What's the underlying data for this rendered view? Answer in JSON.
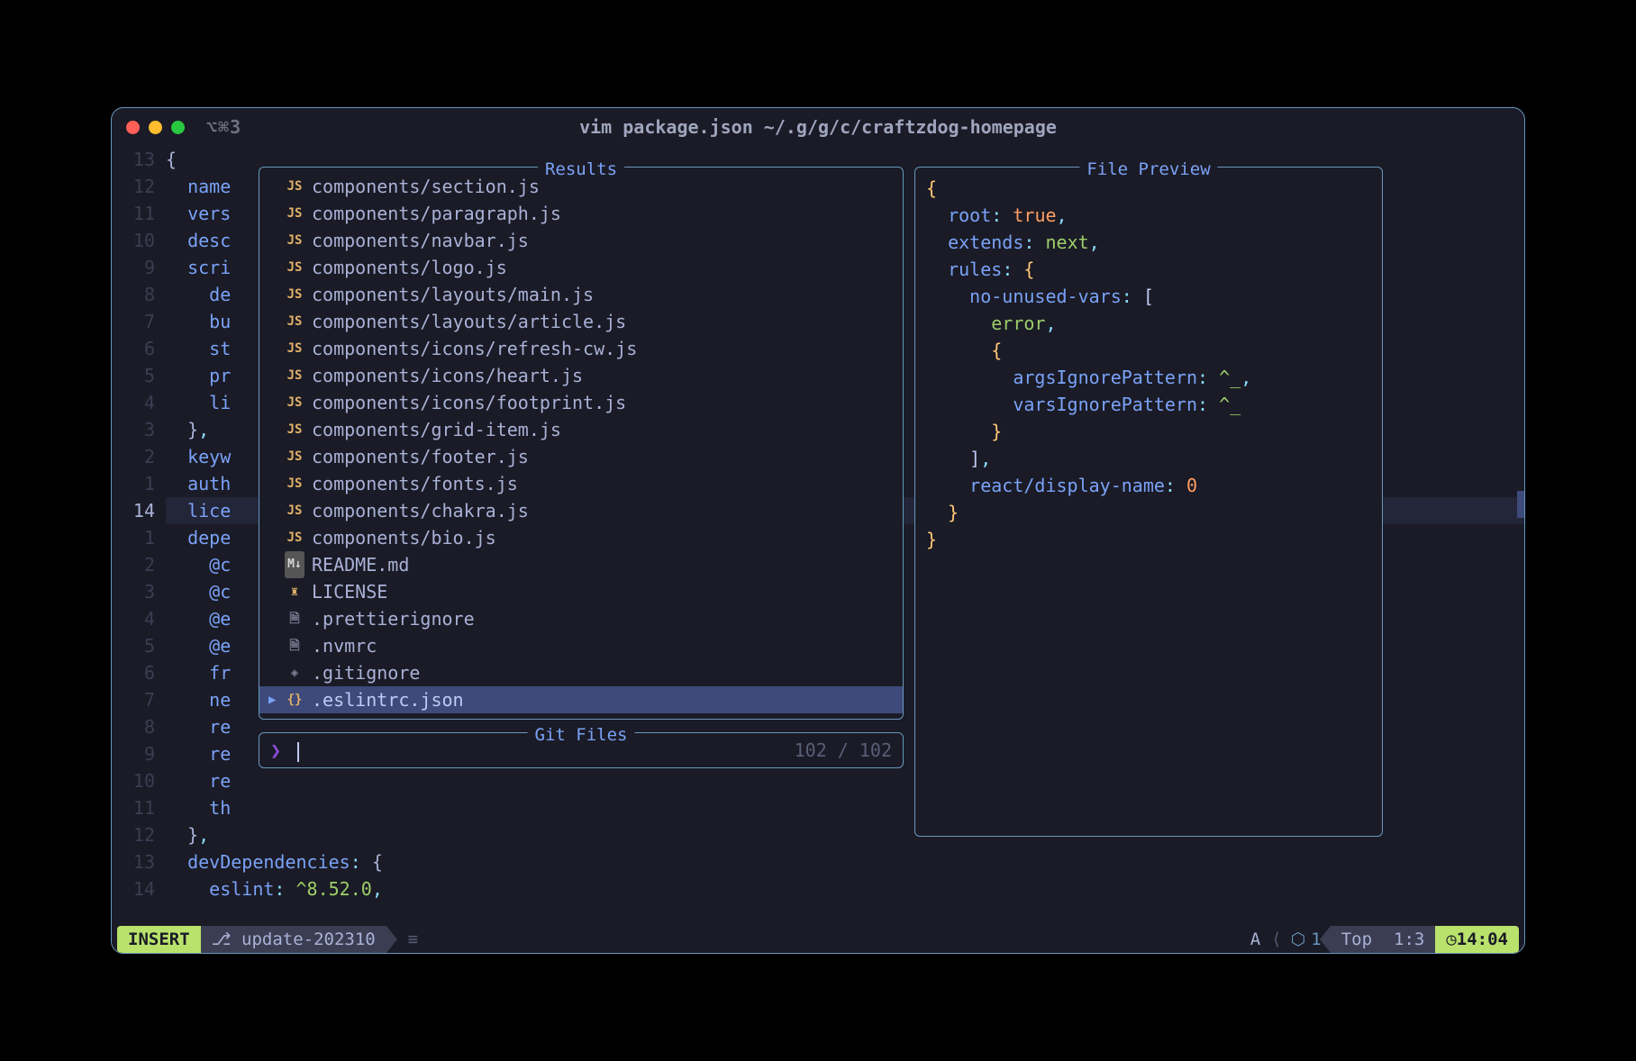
{
  "window": {
    "tab_indicator": "⌥⌘3",
    "title": "vim package.json ~/.g/g/c/craftzdog-homepage"
  },
  "gutter_numbers": [
    "13",
    "12",
    "11",
    "10",
    "9",
    "8",
    "7",
    "6",
    "5",
    "4",
    "3",
    "2",
    "1",
    "14",
    "1",
    "2",
    "3",
    "4",
    "5",
    "6",
    "7",
    "8",
    "9",
    "10",
    "11",
    "12",
    "13",
    "14"
  ],
  "gutter_current_index": 13,
  "code_visible": [
    "{",
    "  name",
    "  vers",
    "  desc",
    "  scri",
    "    de",
    "    bu",
    "    st",
    "    pr",
    "    li",
    "  },",
    "  keyw",
    "  auth",
    "  lice",
    "  depe",
    "    @c",
    "    @c",
    "    @e",
    "    @e",
    "    fr",
    "    ne",
    "    re",
    "    re",
    "    re",
    "    th",
    "  },",
    "  devDependencies: {",
    "    eslint: ^8.52.0,"
  ],
  "code_key_end": {
    "devDependencies": "devDependencies",
    "eslint": "eslint",
    "eslint_ver": "^8.52.0"
  },
  "panels": {
    "results_title": "Results",
    "gitfiles_title": "Git Files",
    "preview_title": "File Preview"
  },
  "results": [
    {
      "icon": "JS",
      "cls": "ic-js",
      "name": "components/section.js"
    },
    {
      "icon": "JS",
      "cls": "ic-js",
      "name": "components/paragraph.js"
    },
    {
      "icon": "JS",
      "cls": "ic-js",
      "name": "components/navbar.js"
    },
    {
      "icon": "JS",
      "cls": "ic-js",
      "name": "components/logo.js"
    },
    {
      "icon": "JS",
      "cls": "ic-js",
      "name": "components/layouts/main.js"
    },
    {
      "icon": "JS",
      "cls": "ic-js",
      "name": "components/layouts/article.js"
    },
    {
      "icon": "JS",
      "cls": "ic-js",
      "name": "components/icons/refresh-cw.js"
    },
    {
      "icon": "JS",
      "cls": "ic-js",
      "name": "components/icons/heart.js"
    },
    {
      "icon": "JS",
      "cls": "ic-js",
      "name": "components/icons/footprint.js"
    },
    {
      "icon": "JS",
      "cls": "ic-js",
      "name": "components/grid-item.js"
    },
    {
      "icon": "JS",
      "cls": "ic-js",
      "name": "components/footer.js"
    },
    {
      "icon": "JS",
      "cls": "ic-js",
      "name": "components/fonts.js"
    },
    {
      "icon": "JS",
      "cls": "ic-js",
      "name": "components/chakra.js"
    },
    {
      "icon": "JS",
      "cls": "ic-js",
      "name": "components/bio.js"
    },
    {
      "icon": "M↓",
      "cls": "ic-md",
      "name": "README.md"
    },
    {
      "icon": "♜",
      "cls": "ic-lic",
      "name": "LICENSE"
    },
    {
      "icon": "🗎",
      "cls": "ic-txt",
      "name": ".prettierignore"
    },
    {
      "icon": "🗎",
      "cls": "ic-txt",
      "name": ".nvmrc"
    },
    {
      "icon": "◈",
      "cls": "ic-git",
      "name": ".gitignore"
    },
    {
      "icon": "{}",
      "cls": "ic-json",
      "name": ".eslintrc.json",
      "selected": true
    }
  ],
  "search": {
    "prompt": "❯",
    "count_current": "102",
    "count_total": "102"
  },
  "preview_lines": [
    {
      "t": "{",
      "c": "pv-brace"
    },
    {
      "t": "  root: true,",
      "seg": [
        [
          "  ",
          "pv"
        ],
        [
          "root",
          "pv-key"
        ],
        [
          ": ",
          "pv-punct"
        ],
        [
          "true",
          "pv-bool"
        ],
        [
          ",",
          "pv-punct"
        ]
      ]
    },
    {
      "t": "  extends: next,",
      "seg": [
        [
          "  ",
          "pv"
        ],
        [
          "extends",
          "pv-key"
        ],
        [
          ": ",
          "pv-punct"
        ],
        [
          "next",
          "pv-str"
        ],
        [
          ",",
          "pv-punct"
        ]
      ]
    },
    {
      "t": "  rules: {",
      "seg": [
        [
          "  ",
          "pv"
        ],
        [
          "rules",
          "pv-key"
        ],
        [
          ": ",
          "pv-punct"
        ],
        [
          "{",
          "pv-brace"
        ]
      ]
    },
    {
      "t": "    no-unused-vars: [",
      "seg": [
        [
          "    ",
          "pv"
        ],
        [
          "no-unused-vars",
          "pv-key"
        ],
        [
          ": ",
          "pv-punct"
        ],
        [
          "[",
          "pv-brk"
        ]
      ]
    },
    {
      "t": "      error,",
      "seg": [
        [
          "      ",
          "pv"
        ],
        [
          "error",
          "pv-str"
        ],
        [
          ",",
          "pv-punct"
        ]
      ]
    },
    {
      "t": "      {",
      "seg": [
        [
          "      ",
          "pv"
        ],
        [
          "{",
          "pv-brace"
        ]
      ]
    },
    {
      "t": "        argsIgnorePattern: ^_,",
      "seg": [
        [
          "        ",
          "pv"
        ],
        [
          "argsIgnorePattern",
          "pv-key"
        ],
        [
          ": ",
          "pv-punct"
        ],
        [
          "^_",
          "pv-str"
        ],
        [
          ",",
          "pv-punct"
        ]
      ]
    },
    {
      "t": "        varsIgnorePattern: ^_",
      "seg": [
        [
          "        ",
          "pv"
        ],
        [
          "varsIgnorePattern",
          "pv-key"
        ],
        [
          ": ",
          "pv-punct"
        ],
        [
          "^_",
          "pv-str"
        ]
      ]
    },
    {
      "t": "      }",
      "seg": [
        [
          "      ",
          "pv"
        ],
        [
          "}",
          "pv-brace"
        ]
      ]
    },
    {
      "t": "    ],",
      "seg": [
        [
          "    ",
          "pv"
        ],
        [
          "]",
          "pv-brk"
        ],
        [
          ",",
          "pv-punct"
        ]
      ]
    },
    {
      "t": "    react/display-name: 0",
      "seg": [
        [
          "    ",
          "pv"
        ],
        [
          "react/display-name",
          "pv-key"
        ],
        [
          ": ",
          "pv-punct"
        ],
        [
          "0",
          "pv-num"
        ]
      ]
    },
    {
      "t": "  }",
      "seg": [
        [
          "  ",
          "pv"
        ],
        [
          "}",
          "pv-brace"
        ]
      ]
    },
    {
      "t": "}",
      "c": "pv-brace"
    }
  ],
  "statusbar": {
    "mode": "INSERT",
    "branch_icon": "⎇",
    "branch": "update-202310",
    "mid_icon": "≡",
    "diag": "A",
    "cube_icon": "⬡",
    "cube_n": "1",
    "scroll": "Top",
    "pos": "1:3",
    "clock_icon": "◷",
    "time": "14:04"
  }
}
